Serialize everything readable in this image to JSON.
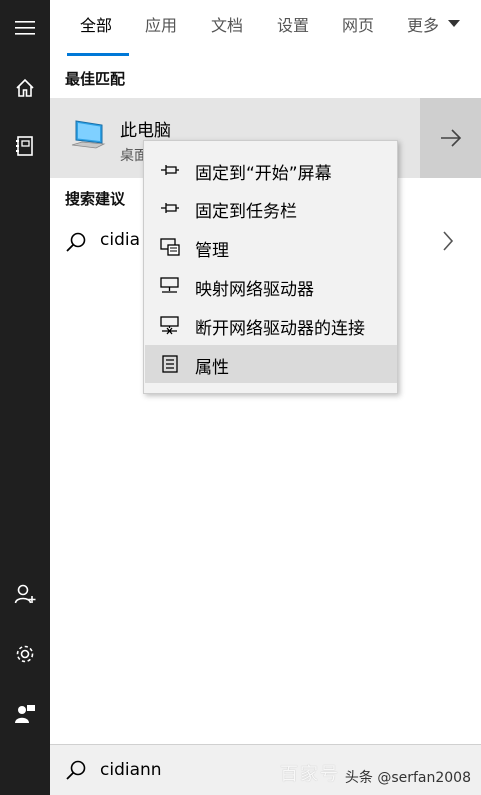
{
  "rail": {
    "icons": [
      "hamburger-icon",
      "home-icon",
      "notebook-icon",
      "add-user-icon",
      "settings-icon",
      "feedback-icon"
    ]
  },
  "tabs": {
    "all": "全部",
    "apps": "应用",
    "documents": "文档",
    "settings": "设置",
    "web": "网页",
    "more": "更多"
  },
  "best_match": {
    "section_label": "最佳匹配",
    "title": "此电脑",
    "subtitle": "桌面"
  },
  "suggestions": {
    "section_label": "搜索建议",
    "items": [
      {
        "text": "cidia"
      }
    ]
  },
  "context_menu": {
    "items": [
      {
        "label": "固定到“开始”屏幕",
        "icon": "pin-icon"
      },
      {
        "label": "固定到任务栏",
        "icon": "pin-taskbar-icon"
      },
      {
        "label": "管理",
        "icon": "manage-icon"
      },
      {
        "label": "映射网络驱动器",
        "icon": "map-network-drive-icon"
      },
      {
        "label": "断开网络驱动器的连接",
        "icon": "disconnect-network-drive-icon"
      },
      {
        "label": "属性",
        "icon": "properties-icon",
        "highlighted": true
      }
    ]
  },
  "search": {
    "value": "cidiann"
  },
  "watermark": "百家号",
  "credit": "头条 @serfan2008",
  "colors": {
    "accent": "#0078d7",
    "rail": "#1f1f1f",
    "best_match_bg": "#e5e5e5",
    "menu_bg": "#f2f2f2",
    "menu_highlight": "#dadada"
  }
}
